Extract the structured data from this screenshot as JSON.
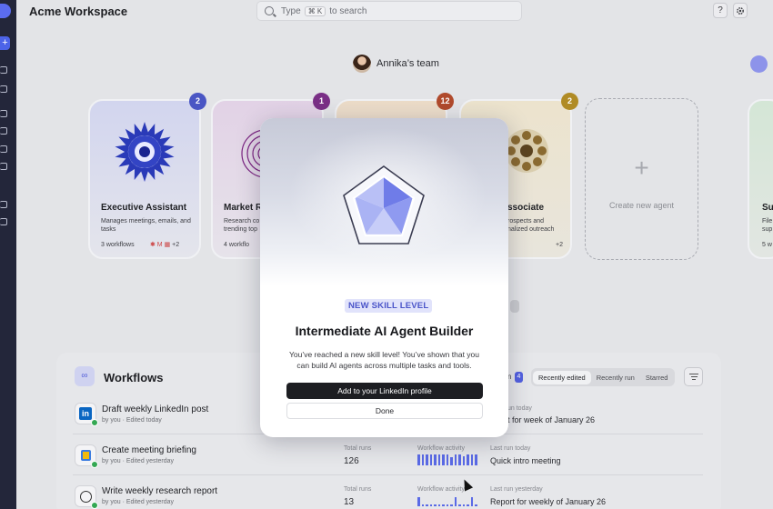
{
  "app": {
    "title": "Acme Workspace"
  },
  "search": {
    "label_before": "Type",
    "shortcut": "⌘ K",
    "label_after": "to search"
  },
  "header": {
    "help_label": "?",
    "settings_icon": "gear-icon"
  },
  "team": {
    "name": "Annika’s team"
  },
  "agents": [
    {
      "name": "Executive Assistant",
      "description": "Manages meetings, emails, and tasks",
      "workflows": "3 workflows",
      "extra": "+2",
      "badge": "2",
      "badge_color": "#4a56c4"
    },
    {
      "name": "Market R",
      "description": "Research co trending top",
      "workflows": "4 workflo",
      "badge": "1",
      "badge_color": "#7a2f86"
    },
    {
      "badge": "12",
      "badge_color": "#b04a2c"
    },
    {
      "name": "ssociate",
      "description": "rospects and nalized outreach",
      "extra": "+2",
      "badge": "2",
      "badge_color": "#b08b25"
    },
    {
      "name": "Su",
      "description": "File sup",
      "workflows": "5 w"
    }
  ],
  "create_agent": {
    "plus": "+",
    "label": "Create new agent"
  },
  "workflows": {
    "title": "Workflows",
    "count_prefix": "n",
    "count": "4",
    "tabs": [
      "Recently edited",
      "Recently run",
      "Starred"
    ],
    "rows": [
      {
        "title": "Draft weekly LinkedIn post",
        "owner": "by you",
        "edited": "Edited today",
        "last_run_label": "un today",
        "last_run_value": "t for week of January 26"
      },
      {
        "title": "Create meeting briefing",
        "owner": "by you",
        "edited": "Edited yesterday",
        "total_runs_label": "Total runs",
        "total_runs": "126",
        "activity_label": "Workflow activity",
        "last_run_label": "Last run today",
        "last_run_value": "Quick intro meeting"
      },
      {
        "title": "Write weekly research report",
        "owner": "by you",
        "edited": "Edited yesterday",
        "total_runs_label": "Total runs",
        "total_runs": "13",
        "activity_label": "Workflow activity",
        "last_run_label": "Last run yesterday",
        "last_run_value": "Report for weekly of January 26"
      }
    ]
  },
  "modal": {
    "pill": "NEW SKILL LEVEL",
    "title": "Intermediate AI Agent Builder",
    "body": "You’ve reached a new skill level! You’ve shown that you can build AI agents across multiple tasks and tools.",
    "primary_button": "Add to your LinkedIn profile",
    "secondary_button": "Done"
  },
  "colors": {
    "accent": "#5260e0",
    "rail": "#23263a"
  }
}
